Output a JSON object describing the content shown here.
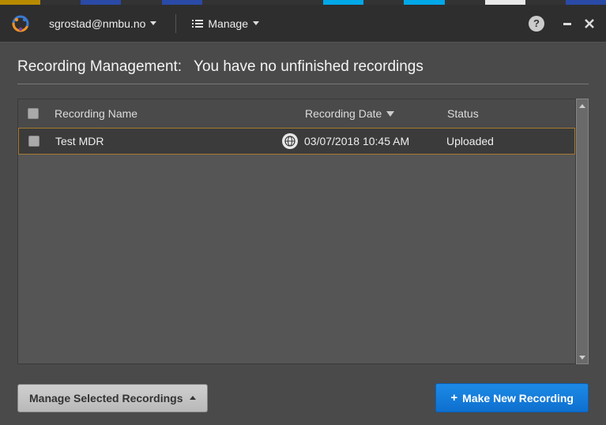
{
  "tab_colors": [
    "#b88a00",
    "#333333",
    "#2a4aa8",
    "#333333",
    "#2a4aa8",
    "#333333",
    "#333333",
    "#333333",
    "#00a8e8",
    "#333333",
    "#00a8e8",
    "#333333",
    "#e8e8e8",
    "#333333",
    "#2a4aa8"
  ],
  "header": {
    "username": "sgrostad@nmbu.no",
    "manage_label": "Manage",
    "help_label": "?"
  },
  "page": {
    "title_prefix": "Recording Management:",
    "title_body": "You have no unfinished recordings"
  },
  "table": {
    "columns": {
      "name": "Recording Name",
      "date": "Recording Date",
      "status": "Status"
    },
    "rows": [
      {
        "name": "Test MDR",
        "date": "03/07/2018 10:45 AM",
        "status": "Uploaded"
      }
    ]
  },
  "footer": {
    "manage_selected": "Manage Selected Recordings",
    "make_new": "Make New Recording"
  }
}
